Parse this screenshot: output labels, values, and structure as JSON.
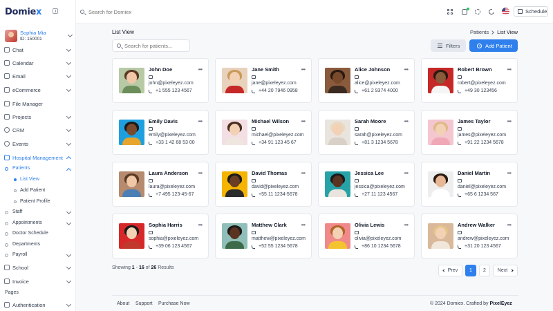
{
  "brand": {
    "name_main": "Domie",
    "name_accent": "x"
  },
  "user": {
    "name": "Sophia Mia",
    "id": "ID: 150001"
  },
  "sidebar": {
    "items": [
      {
        "label": "Chat",
        "icon": "chat-icon"
      },
      {
        "label": "Calendar",
        "icon": "calendar-icon"
      },
      {
        "label": "Email",
        "icon": "email-icon"
      },
      {
        "label": "eCommerce",
        "icon": "cart-icon"
      },
      {
        "label": "File Manager",
        "icon": "folder-icon"
      },
      {
        "label": "Projects",
        "icon": "projects-icon"
      },
      {
        "label": "CRM",
        "icon": "crm-icon"
      },
      {
        "label": "Events",
        "icon": "events-icon"
      },
      {
        "label": "Hospital Management",
        "icon": "hospital-icon"
      }
    ],
    "hospital_sub": {
      "patients": "Patients",
      "patients_sub": [
        "List View",
        "Add Patient",
        "Patient Profile"
      ],
      "others": [
        "Staff",
        "Appointments",
        "Doctor Schedule",
        "Departments",
        "Payroll"
      ]
    },
    "after": [
      {
        "label": "School",
        "icon": "school-icon"
      },
      {
        "label": "Invoice",
        "icon": "invoice-icon"
      }
    ],
    "section_pages": "Pages",
    "authentication": "Authentication"
  },
  "header": {
    "search_placeholder": "Search for Domiex",
    "schedule_label": "Schedule",
    "icons": [
      "grid-icon",
      "bell-icon",
      "gear-icon",
      "moon-icon",
      "flag-icon"
    ]
  },
  "page": {
    "title": "List View",
    "breadcrumb": [
      "Patients",
      "List View"
    ],
    "search_placeholder": "Search for patients...",
    "filters_label": "Filters",
    "add_label": "Add Patient"
  },
  "patients": [
    {
      "name": "John Doe",
      "email": "john@pixeleyez.com",
      "phone": "+1 555 123 4567"
    },
    {
      "name": "Jane Smith",
      "email": "jane@pixeleyez.com",
      "phone": "+44 20 7946 0958"
    },
    {
      "name": "Alice Johnson",
      "email": "alice@pixeleyez.com",
      "phone": "+61 2 9374 4000"
    },
    {
      "name": "Robert Brown",
      "email": "robert@pixeleyez.com",
      "phone": "+49 30 123456"
    },
    {
      "name": "Emily Davis",
      "email": "emily@pixeleyez.com",
      "phone": "+33 1 42 68 53 00"
    },
    {
      "name": "Michael Wilson",
      "email": "michael@pixeleyez.com",
      "phone": "+34 91 123 45 67"
    },
    {
      "name": "Sarah Moore",
      "email": "sarah@pixeleyez.com",
      "phone": "+81 3 1234 5678"
    },
    {
      "name": "James Taylor",
      "email": "james@pixeleyez.com",
      "phone": "+91 22 1234 5678"
    },
    {
      "name": "Laura Anderson",
      "email": "laura@pixeleyez.com",
      "phone": "+7 495 123-45-67"
    },
    {
      "name": "David Thomas",
      "email": "david@pixeleyez.com",
      "phone": "+55 11 1234-5678"
    },
    {
      "name": "Jessica Lee",
      "email": "jessica@pixeleyez.com",
      "phone": "+27 11 123 4567"
    },
    {
      "name": "Daniel Martin",
      "email": "daniel@pixeleyez.com",
      "phone": "+65 6 1234 567"
    },
    {
      "name": "Sophia Harris",
      "email": "sophia@pixeleyez.com",
      "phone": "+39 06 123 4567"
    },
    {
      "name": "Matthew Clark",
      "email": "matthew@pixeleyez.com",
      "phone": "+52 55 1234 5678"
    },
    {
      "name": "Olivia Lewis",
      "email": "olivia@pixeleyez.com",
      "phone": "+86 10 1234 5678"
    },
    {
      "name": "Andrew Walker",
      "email": "andrew@pixeleyez.com",
      "phone": "+31 20 123 4567"
    }
  ],
  "photo_colors": [
    {
      "bg": "#b7c9a5",
      "skin": "#f0c8a8",
      "hair": "#5a3a22",
      "shirt": "#6b8e5a"
    },
    {
      "bg": "#e8d2bc",
      "skin": "#f3d1b5",
      "hair": "#c99a5c",
      "shirt": "#c62828"
    },
    {
      "bg": "#8a5a3c",
      "skin": "#7a4a2c",
      "hair": "#2b1a10",
      "shirt": "#3b2a20"
    },
    {
      "bg": "#c62828",
      "skin": "#8a5a3a",
      "hair": "#2b1a10",
      "shirt": "#f5f5f5"
    },
    {
      "bg": "#1ea0e0",
      "skin": "#7a4a2c",
      "hair": "#1b1b1b",
      "shirt": "#e7a52d"
    },
    {
      "bg": "#f3dfe3",
      "skin": "#f3d1b5",
      "hair": "#4a2e1e",
      "shirt": "#efe6df"
    },
    {
      "bg": "#e9e4dd",
      "skin": "#f3d1b5",
      "hair": "#e8d9c0",
      "shirt": "#d9d1c7"
    },
    {
      "bg": "#f4c6cf",
      "skin": "#f3d1b5",
      "hair": "#e0b98a",
      "shirt": "#f0a8b6"
    },
    {
      "bg": "#b58a6e",
      "skin": "#f0c8a8",
      "hair": "#5a3a22",
      "shirt": "#4a7fb5"
    },
    {
      "bg": "#f4b400",
      "skin": "#6a3e24",
      "hair": "#1b1b1b",
      "shirt": "#2b2b2b"
    },
    {
      "bg": "#27a3a8",
      "skin": "#5a3420",
      "hair": "#1b1b1b",
      "shirt": "#e9e4dd"
    },
    {
      "bg": "#eeeeee",
      "skin": "#e8b896",
      "hair": "#2b1a10",
      "shirt": "#ffffff"
    },
    {
      "bg": "#d62828",
      "skin": "#f3d1b5",
      "hair": "#1b1b1b",
      "shirt": "#c0392b"
    },
    {
      "bg": "#8fbfb8",
      "skin": "#5a3420",
      "hair": "#1b1b1b",
      "shirt": "#3d6b4a"
    },
    {
      "bg": "#f08a8a",
      "skin": "#f3d1b5",
      "hair": "#b5652a",
      "shirt": "#f4c430"
    },
    {
      "bg": "#d9b99a",
      "skin": "#f3d1b5",
      "hair": "#e3c48a",
      "shirt": "#f0e6da"
    }
  ],
  "pagination": {
    "showing_prefix": "Showing ",
    "from": "1",
    "dash": " - ",
    "to": "16",
    "of_text": " of ",
    "total": "26",
    "suffix": " Results",
    "prev": "Prev",
    "pages": [
      "1",
      "2"
    ],
    "next": "Next"
  },
  "footer": {
    "links": [
      "About",
      "Support",
      "Purchase Now"
    ],
    "copyright_prefix": "© 2024 Domiex. Crafted by ",
    "copyright_brand": "PixelEyez"
  },
  "colors": {
    "accent": "#2f80ed",
    "text": "#1f2937",
    "background": "#f7f8fa"
  }
}
